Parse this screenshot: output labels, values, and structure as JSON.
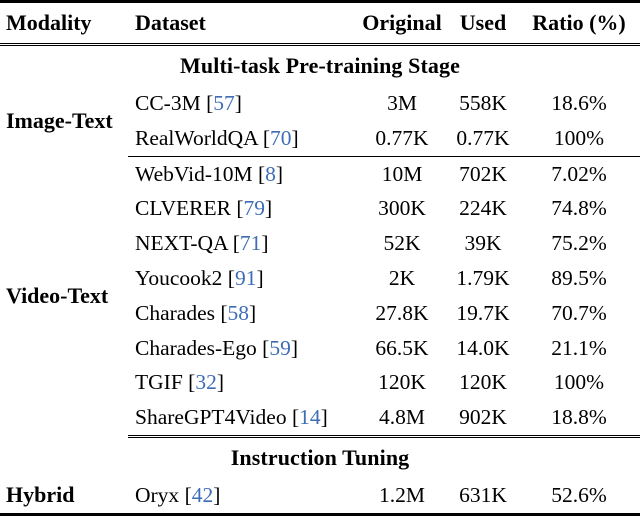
{
  "table": {
    "columns": [
      {
        "key": "modality",
        "label": "Modality",
        "align": "left"
      },
      {
        "key": "dataset",
        "label": "Dataset",
        "align": "left"
      },
      {
        "key": "original",
        "label": "Original",
        "align": "center"
      },
      {
        "key": "used",
        "label": "Used",
        "align": "center"
      },
      {
        "key": "ratio",
        "label": "Ratio (%)",
        "align": "center"
      }
    ],
    "citation_color": "#3e6db5",
    "sections": [
      {
        "title": "Multi-task Pre-training Stage",
        "groups": [
          {
            "modality": "Image-Text",
            "rows": [
              {
                "dataset": "CC-3M",
                "cite": "57",
                "original": "3M",
                "used": "558K",
                "ratio": "18.6%"
              },
              {
                "dataset": "RealWorldQA",
                "cite": "70",
                "original": "0.77K",
                "used": "0.77K",
                "ratio": "100%"
              }
            ]
          },
          {
            "modality": "Video-Text",
            "rows": [
              {
                "dataset": "WebVid-10M",
                "cite": "8",
                "original": "10M",
                "used": "702K",
                "ratio": "7.02%"
              },
              {
                "dataset": "CLVERER",
                "cite": "79",
                "original": "300K",
                "used": "224K",
                "ratio": "74.8%"
              },
              {
                "dataset": "NEXT-QA",
                "cite": "71",
                "original": "52K",
                "used": "39K",
                "ratio": "75.2%"
              },
              {
                "dataset": "Youcook2",
                "cite": "91",
                "original": "2K",
                "used": "1.79K",
                "ratio": "89.5%"
              },
              {
                "dataset": "Charades",
                "cite": "58",
                "original": "27.8K",
                "used": "19.7K",
                "ratio": "70.7%"
              },
              {
                "dataset": "Charades-Ego",
                "cite": "59",
                "original": "66.5K",
                "used": "14.0K",
                "ratio": "21.1%"
              },
              {
                "dataset": "TGIF",
                "cite": "32",
                "original": "120K",
                "used": "120K",
                "ratio": "100%"
              },
              {
                "dataset": "ShareGPT4Video",
                "cite": "14",
                "original": "4.8M",
                "used": "902K",
                "ratio": "18.8%"
              }
            ]
          }
        ]
      },
      {
        "title": "Instruction Tuning",
        "groups": [
          {
            "modality": "Hybrid",
            "rows": [
              {
                "dataset": "Oryx",
                "cite": "42",
                "original": "1.2M",
                "used": "631K",
                "ratio": "52.6%"
              }
            ]
          }
        ]
      }
    ]
  }
}
